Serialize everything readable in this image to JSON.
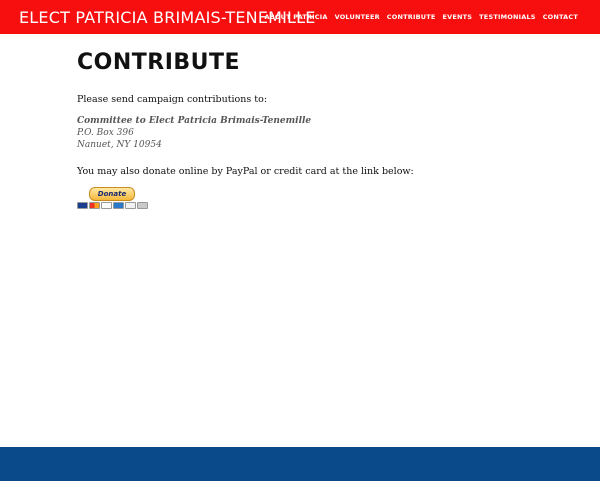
{
  "header": {
    "site_title": "ELECT PATRICIA BRIMAIS-TENEMILLE",
    "nav": [
      "ABOUT PATRICIA",
      "VOLUNTEER",
      "CONTRIBUTE",
      "EVENTS",
      "TESTIMONIALS",
      "CONTACT"
    ]
  },
  "main": {
    "title": "CONTRIBUTE",
    "intro": "Please send campaign contributions to:",
    "address": {
      "committee": "Committee to Elect Patricia Brimais-Tenemille",
      "line1": "P.O. Box 396",
      "line2": "Nanuet, NY 10954"
    },
    "online_text": "You may also donate online by PayPal or credit card at the link below:",
    "donate_label": "Donate",
    "payment_icons": [
      "visa-card-icon",
      "mastercard-icon",
      "visa-icon",
      "amex-icon",
      "discover-icon",
      "bank-icon"
    ]
  },
  "colors": {
    "header_bg": "#f70f0f",
    "footer_bg": "#0b4a8a",
    "text": "#111111"
  }
}
